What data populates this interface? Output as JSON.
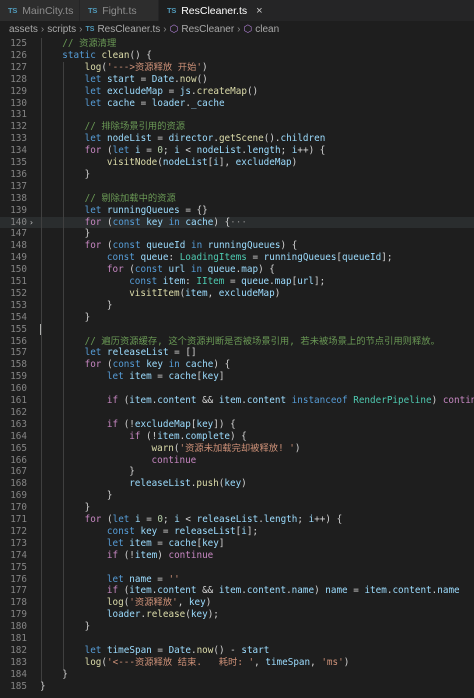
{
  "tabs": [
    {
      "icon": "TS",
      "label": "MainCity.ts",
      "active": false
    },
    {
      "icon": "TS",
      "label": "Fight.ts",
      "active": false
    },
    {
      "icon": "TS",
      "label": "ResCleaner.ts",
      "active": true,
      "close": "×"
    }
  ],
  "breadcrumb": [
    "assets",
    "scripts",
    "ResCleaner.ts",
    "ResCleaner",
    "clean"
  ],
  "lines": [
    {
      "n": "125",
      "ind": 1,
      "t": [
        [
          "cm",
          "// 资源清理"
        ]
      ]
    },
    {
      "n": "126",
      "ind": 1,
      "t": [
        [
          "kw",
          "static "
        ],
        [
          "fn",
          "clean"
        ],
        [
          "op",
          "() {"
        ]
      ]
    },
    {
      "n": "127",
      "ind": 2,
      "t": [
        [
          "fn",
          "log"
        ],
        [
          "op",
          "("
        ],
        [
          "str",
          "'--->资源释放 开始'"
        ],
        [
          "op",
          ")"
        ]
      ]
    },
    {
      "n": "128",
      "ind": 2,
      "t": [
        [
          "kw",
          "let "
        ],
        [
          "var",
          "start"
        ],
        [
          "op",
          " = "
        ],
        [
          "var",
          "Date"
        ],
        [
          "op",
          "."
        ],
        [
          "fn",
          "now"
        ],
        [
          "op",
          "()"
        ]
      ]
    },
    {
      "n": "129",
      "ind": 2,
      "t": [
        [
          "kw",
          "let "
        ],
        [
          "var",
          "excludeMap"
        ],
        [
          "op",
          " = "
        ],
        [
          "var",
          "js"
        ],
        [
          "op",
          "."
        ],
        [
          "fn",
          "createMap"
        ],
        [
          "op",
          "()"
        ]
      ]
    },
    {
      "n": "130",
      "ind": 2,
      "t": [
        [
          "kw",
          "let "
        ],
        [
          "var",
          "cache"
        ],
        [
          "op",
          " = "
        ],
        [
          "var",
          "loader"
        ],
        [
          "op",
          "."
        ],
        [
          "var",
          "_cache"
        ]
      ]
    },
    {
      "n": "131",
      "ind": 0,
      "t": []
    },
    {
      "n": "132",
      "ind": 2,
      "t": [
        [
          "cm",
          "// 排除场景引用的资源"
        ]
      ]
    },
    {
      "n": "133",
      "ind": 2,
      "t": [
        [
          "kw",
          "let "
        ],
        [
          "var",
          "nodeList"
        ],
        [
          "op",
          " = "
        ],
        [
          "var",
          "director"
        ],
        [
          "op",
          "."
        ],
        [
          "fn",
          "getScene"
        ],
        [
          "op",
          "()."
        ],
        [
          "var",
          "children"
        ]
      ]
    },
    {
      "n": "134",
      "ind": 2,
      "t": [
        [
          "ctrl",
          "for "
        ],
        [
          "op",
          "("
        ],
        [
          "kw",
          "let "
        ],
        [
          "var",
          "i"
        ],
        [
          "op",
          " = "
        ],
        [
          "num",
          "0"
        ],
        [
          "op",
          "; "
        ],
        [
          "var",
          "i"
        ],
        [
          "op",
          " < "
        ],
        [
          "var",
          "nodeList"
        ],
        [
          "op",
          "."
        ],
        [
          "var",
          "length"
        ],
        [
          "op",
          "; "
        ],
        [
          "var",
          "i"
        ],
        [
          "op",
          "++) {"
        ]
      ]
    },
    {
      "n": "135",
      "ind": 3,
      "t": [
        [
          "fn",
          "visitNode"
        ],
        [
          "op",
          "("
        ],
        [
          "var",
          "nodeList"
        ],
        [
          "op",
          "["
        ],
        [
          "var",
          "i"
        ],
        [
          "op",
          "], "
        ],
        [
          "var",
          "excludeMap"
        ],
        [
          "op",
          ")"
        ]
      ]
    },
    {
      "n": "136",
      "ind": 2,
      "t": [
        [
          "op",
          "}"
        ]
      ]
    },
    {
      "n": "137",
      "ind": 0,
      "t": []
    },
    {
      "n": "138",
      "ind": 2,
      "t": [
        [
          "cm",
          "// 剔除加载中的资源"
        ]
      ]
    },
    {
      "n": "139",
      "ind": 2,
      "t": [
        [
          "kw",
          "let "
        ],
        [
          "var",
          "runningQueues"
        ],
        [
          "op",
          " = {}"
        ]
      ]
    },
    {
      "n": "140",
      "ind": 2,
      "fold": "›",
      "hl": true,
      "t": [
        [
          "ctrl",
          "for "
        ],
        [
          "op",
          "("
        ],
        [
          "kw",
          "const "
        ],
        [
          "var",
          "key"
        ],
        [
          "kw",
          " in "
        ],
        [
          "var",
          "cache"
        ],
        [
          "op",
          ") {"
        ],
        [
          "ellip",
          "···"
        ]
      ]
    },
    {
      "n": "147",
      "ind": 2,
      "t": [
        [
          "op",
          "}"
        ]
      ]
    },
    {
      "n": "148",
      "ind": 2,
      "t": [
        [
          "ctrl",
          "for "
        ],
        [
          "op",
          "("
        ],
        [
          "kw",
          "const "
        ],
        [
          "var",
          "queueId"
        ],
        [
          "kw",
          " in "
        ],
        [
          "var",
          "runningQueues"
        ],
        [
          "op",
          ") {"
        ]
      ]
    },
    {
      "n": "149",
      "ind": 3,
      "t": [
        [
          "kw",
          "const "
        ],
        [
          "var",
          "queue"
        ],
        [
          "op",
          ": "
        ],
        [
          "ty",
          "LoadingItems"
        ],
        [
          "op",
          " = "
        ],
        [
          "var",
          "runningQueues"
        ],
        [
          "op",
          "["
        ],
        [
          "var",
          "queueId"
        ],
        [
          "op",
          "];"
        ]
      ]
    },
    {
      "n": "150",
      "ind": 3,
      "t": [
        [
          "ctrl",
          "for "
        ],
        [
          "op",
          "("
        ],
        [
          "kw",
          "const "
        ],
        [
          "var",
          "url"
        ],
        [
          "kw",
          " in "
        ],
        [
          "var",
          "queue"
        ],
        [
          "op",
          "."
        ],
        [
          "var",
          "map"
        ],
        [
          "op",
          ") {"
        ]
      ]
    },
    {
      "n": "151",
      "ind": 4,
      "t": [
        [
          "kw",
          "const "
        ],
        [
          "var",
          "item"
        ],
        [
          "op",
          ": "
        ],
        [
          "ty",
          "IItem"
        ],
        [
          "op",
          " = "
        ],
        [
          "var",
          "queue"
        ],
        [
          "op",
          "."
        ],
        [
          "var",
          "map"
        ],
        [
          "op",
          "["
        ],
        [
          "var",
          "url"
        ],
        [
          "op",
          "];"
        ]
      ]
    },
    {
      "n": "152",
      "ind": 4,
      "t": [
        [
          "fn",
          "visitItem"
        ],
        [
          "op",
          "("
        ],
        [
          "var",
          "item"
        ],
        [
          "op",
          ", "
        ],
        [
          "var",
          "excludeMap"
        ],
        [
          "op",
          ")"
        ]
      ]
    },
    {
      "n": "153",
      "ind": 3,
      "t": [
        [
          "op",
          "}"
        ]
      ]
    },
    {
      "n": "154",
      "ind": 2,
      "t": [
        [
          "op",
          "}"
        ]
      ]
    },
    {
      "n": "155",
      "ind": 0,
      "cursor": true,
      "t": []
    },
    {
      "n": "156",
      "ind": 2,
      "t": [
        [
          "cm",
          "// 遍历资源缓存, 这个资源判断是否被场景引用, 若未被场景上的节点引用则释放。"
        ]
      ]
    },
    {
      "n": "157",
      "ind": 2,
      "t": [
        [
          "kw",
          "let "
        ],
        [
          "var",
          "releaseList"
        ],
        [
          "op",
          " = []"
        ]
      ]
    },
    {
      "n": "158",
      "ind": 2,
      "t": [
        [
          "ctrl",
          "for "
        ],
        [
          "op",
          "("
        ],
        [
          "kw",
          "const "
        ],
        [
          "var",
          "key"
        ],
        [
          "kw",
          " in "
        ],
        [
          "var",
          "cache"
        ],
        [
          "op",
          ") {"
        ]
      ]
    },
    {
      "n": "159",
      "ind": 3,
      "t": [
        [
          "kw",
          "let "
        ],
        [
          "var",
          "item"
        ],
        [
          "op",
          " = "
        ],
        [
          "var",
          "cache"
        ],
        [
          "op",
          "["
        ],
        [
          "var",
          "key"
        ],
        [
          "op",
          "]"
        ]
      ]
    },
    {
      "n": "160",
      "ind": 0,
      "t": []
    },
    {
      "n": "161",
      "ind": 3,
      "t": [
        [
          "ctrl",
          "if "
        ],
        [
          "op",
          "("
        ],
        [
          "var",
          "item"
        ],
        [
          "op",
          "."
        ],
        [
          "var",
          "content"
        ],
        [
          "op",
          " && "
        ],
        [
          "var",
          "item"
        ],
        [
          "op",
          "."
        ],
        [
          "var",
          "content"
        ],
        [
          "kw",
          " instanceof "
        ],
        [
          "ty",
          "RenderPipeline"
        ],
        [
          "op",
          ") "
        ],
        [
          "ctrl",
          "continue"
        ]
      ]
    },
    {
      "n": "162",
      "ind": 0,
      "t": []
    },
    {
      "n": "163",
      "ind": 3,
      "t": [
        [
          "ctrl",
          "if "
        ],
        [
          "op",
          "(!"
        ],
        [
          "var",
          "excludeMap"
        ],
        [
          "op",
          "["
        ],
        [
          "var",
          "key"
        ],
        [
          "op",
          "]) {"
        ]
      ]
    },
    {
      "n": "164",
      "ind": 4,
      "t": [
        [
          "ctrl",
          "if "
        ],
        [
          "op",
          "(!"
        ],
        [
          "var",
          "item"
        ],
        [
          "op",
          "."
        ],
        [
          "var",
          "complete"
        ],
        [
          "op",
          ") {"
        ]
      ]
    },
    {
      "n": "165",
      "ind": 5,
      "t": [
        [
          "fn",
          "warn"
        ],
        [
          "op",
          "("
        ],
        [
          "str",
          "'资源未加载完却被释放! '"
        ],
        [
          "op",
          ")"
        ]
      ]
    },
    {
      "n": "166",
      "ind": 5,
      "t": [
        [
          "ctrl",
          "continue"
        ]
      ]
    },
    {
      "n": "167",
      "ind": 4,
      "t": [
        [
          "op",
          "}"
        ]
      ]
    },
    {
      "n": "168",
      "ind": 4,
      "t": [
        [
          "var",
          "releaseList"
        ],
        [
          "op",
          "."
        ],
        [
          "fn",
          "push"
        ],
        [
          "op",
          "("
        ],
        [
          "var",
          "key"
        ],
        [
          "op",
          ")"
        ]
      ]
    },
    {
      "n": "169",
      "ind": 3,
      "t": [
        [
          "op",
          "}"
        ]
      ]
    },
    {
      "n": "170",
      "ind": 2,
      "t": [
        [
          "op",
          "}"
        ]
      ]
    },
    {
      "n": "171",
      "ind": 2,
      "t": [
        [
          "ctrl",
          "for "
        ],
        [
          "op",
          "("
        ],
        [
          "kw",
          "let "
        ],
        [
          "var",
          "i"
        ],
        [
          "op",
          " = "
        ],
        [
          "num",
          "0"
        ],
        [
          "op",
          "; "
        ],
        [
          "var",
          "i"
        ],
        [
          "op",
          " < "
        ],
        [
          "var",
          "releaseList"
        ],
        [
          "op",
          "."
        ],
        [
          "var",
          "length"
        ],
        [
          "op",
          "; "
        ],
        [
          "var",
          "i"
        ],
        [
          "op",
          "++) {"
        ]
      ]
    },
    {
      "n": "172",
      "ind": 3,
      "t": [
        [
          "kw",
          "const "
        ],
        [
          "var",
          "key"
        ],
        [
          "op",
          " = "
        ],
        [
          "var",
          "releaseList"
        ],
        [
          "op",
          "["
        ],
        [
          "var",
          "i"
        ],
        [
          "op",
          "];"
        ]
      ]
    },
    {
      "n": "173",
      "ind": 3,
      "t": [
        [
          "kw",
          "let "
        ],
        [
          "var",
          "item"
        ],
        [
          "op",
          " = "
        ],
        [
          "var",
          "cache"
        ],
        [
          "op",
          "["
        ],
        [
          "var",
          "key"
        ],
        [
          "op",
          "]"
        ]
      ]
    },
    {
      "n": "174",
      "ind": 3,
      "t": [
        [
          "ctrl",
          "if "
        ],
        [
          "op",
          "(!"
        ],
        [
          "var",
          "item"
        ],
        [
          "op",
          ") "
        ],
        [
          "ctrl",
          "continue"
        ]
      ]
    },
    {
      "n": "175",
      "ind": 0,
      "t": []
    },
    {
      "n": "176",
      "ind": 3,
      "t": [
        [
          "kw",
          "let "
        ],
        [
          "var",
          "name"
        ],
        [
          "op",
          " = "
        ],
        [
          "str",
          "''"
        ]
      ]
    },
    {
      "n": "177",
      "ind": 3,
      "t": [
        [
          "ctrl",
          "if "
        ],
        [
          "op",
          "("
        ],
        [
          "var",
          "item"
        ],
        [
          "op",
          "."
        ],
        [
          "var",
          "content"
        ],
        [
          "op",
          " && "
        ],
        [
          "var",
          "item"
        ],
        [
          "op",
          "."
        ],
        [
          "var",
          "content"
        ],
        [
          "op",
          "."
        ],
        [
          "var",
          "name"
        ],
        [
          "op",
          ") "
        ],
        [
          "var",
          "name"
        ],
        [
          "op",
          " = "
        ],
        [
          "var",
          "item"
        ],
        [
          "op",
          "."
        ],
        [
          "var",
          "content"
        ],
        [
          "op",
          "."
        ],
        [
          "var",
          "name"
        ]
      ]
    },
    {
      "n": "178",
      "ind": 3,
      "t": [
        [
          "fn",
          "log"
        ],
        [
          "op",
          "("
        ],
        [
          "str",
          "'资源释放'"
        ],
        [
          "op",
          ", "
        ],
        [
          "var",
          "key"
        ],
        [
          "op",
          ")"
        ]
      ]
    },
    {
      "n": "179",
      "ind": 3,
      "t": [
        [
          "var",
          "loader"
        ],
        [
          "op",
          "."
        ],
        [
          "fn",
          "release"
        ],
        [
          "op",
          "("
        ],
        [
          "var",
          "key"
        ],
        [
          "op",
          ");"
        ]
      ]
    },
    {
      "n": "180",
      "ind": 2,
      "t": [
        [
          "op",
          "}"
        ]
      ]
    },
    {
      "n": "181",
      "ind": 0,
      "t": []
    },
    {
      "n": "182",
      "ind": 2,
      "t": [
        [
          "kw",
          "let "
        ],
        [
          "var",
          "timeSpan"
        ],
        [
          "op",
          " = "
        ],
        [
          "var",
          "Date"
        ],
        [
          "op",
          "."
        ],
        [
          "fn",
          "now"
        ],
        [
          "op",
          "() - "
        ],
        [
          "var",
          "start"
        ]
      ]
    },
    {
      "n": "183",
      "ind": 2,
      "t": [
        [
          "fn",
          "log"
        ],
        [
          "op",
          "("
        ],
        [
          "str",
          "'<---资源释放 结束.   耗时: '"
        ],
        [
          "op",
          ", "
        ],
        [
          "var",
          "timeSpan"
        ],
        [
          "op",
          ", "
        ],
        [
          "str",
          "'ms'"
        ],
        [
          "op",
          ")"
        ]
      ]
    },
    {
      "n": "184",
      "ind": 1,
      "t": [
        [
          "op",
          "}"
        ]
      ]
    },
    {
      "n": "185",
      "ind": 0,
      "t": [
        [
          "op",
          "}"
        ]
      ]
    }
  ]
}
